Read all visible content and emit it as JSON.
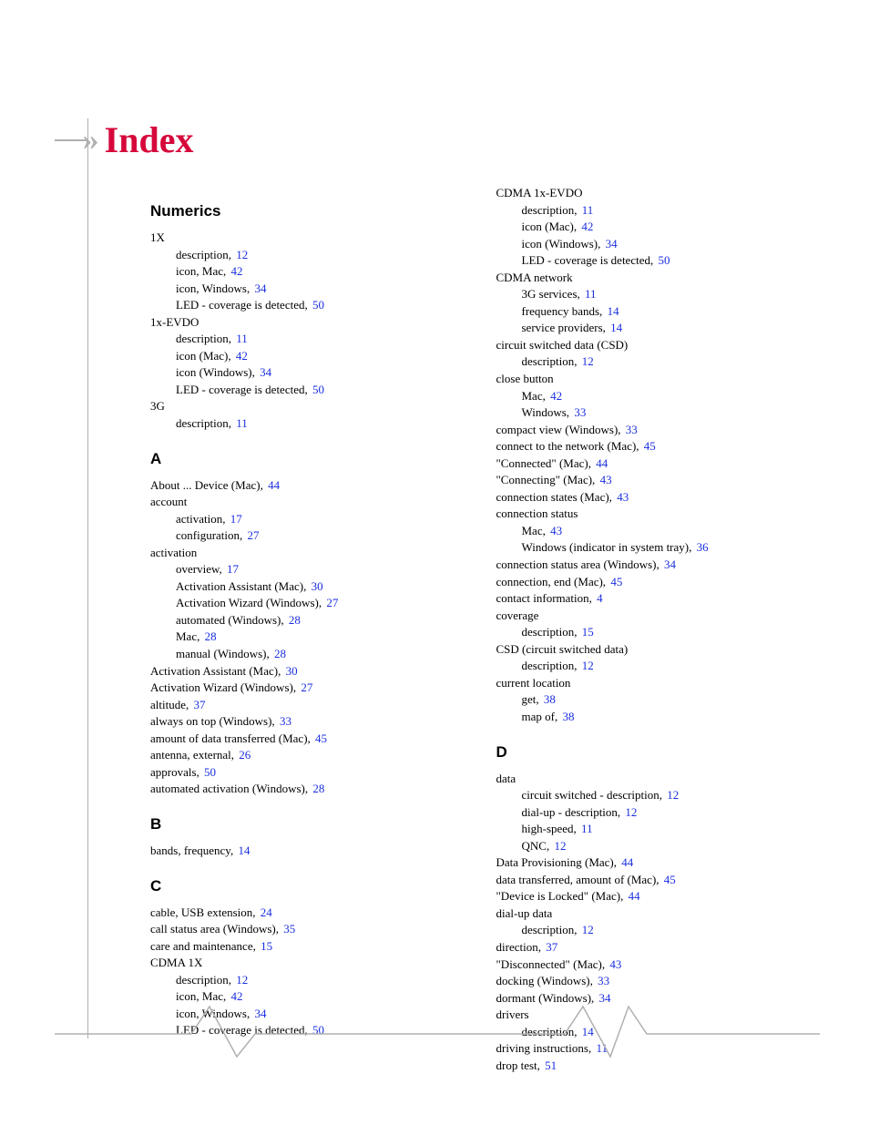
{
  "title": "Index",
  "sections": {
    "numerics": {
      "heading": "Numerics",
      "entries": [
        {
          "text": "1X",
          "lvl": 1
        },
        {
          "text": "description,",
          "page": "12",
          "lvl": 2
        },
        {
          "text": "icon, Mac,",
          "page": "42",
          "lvl": 2
        },
        {
          "text": "icon, Windows,",
          "page": "34",
          "lvl": 2
        },
        {
          "text": "LED - coverage is detected,",
          "page": "50",
          "lvl": 2
        },
        {
          "text": "1x-EVDO",
          "lvl": 1
        },
        {
          "text": "description,",
          "page": "11",
          "lvl": 2
        },
        {
          "text": "icon (Mac),",
          "page": "42",
          "lvl": 2
        },
        {
          "text": "icon (Windows),",
          "page": "34",
          "lvl": 2
        },
        {
          "text": "LED - coverage is detected,",
          "page": "50",
          "lvl": 2
        },
        {
          "text": "3G",
          "lvl": 1
        },
        {
          "text": "description,",
          "page": "11",
          "lvl": 2
        }
      ]
    },
    "a": {
      "heading": "A",
      "entries": [
        {
          "text": "About ... Device (Mac),",
          "page": "44",
          "lvl": 1
        },
        {
          "text": "account",
          "lvl": 1
        },
        {
          "text": "activation,",
          "page": "17",
          "lvl": 2
        },
        {
          "text": "configuration,",
          "page": "27",
          "lvl": 2
        },
        {
          "text": "activation",
          "lvl": 1
        },
        {
          "text": "overview,",
          "page": "17",
          "lvl": 2
        },
        {
          "text": "Activation Assistant (Mac),",
          "page": "30",
          "lvl": 2
        },
        {
          "text": "Activation Wizard (Windows),",
          "page": "27",
          "lvl": 2
        },
        {
          "text": "automated (Windows),",
          "page": "28",
          "lvl": 2
        },
        {
          "text": "Mac,",
          "page": "28",
          "lvl": 2
        },
        {
          "text": "manual (Windows),",
          "page": "28",
          "lvl": 2
        },
        {
          "text": "Activation Assistant (Mac),",
          "page": "30",
          "lvl": 1
        },
        {
          "text": "Activation Wizard (Windows),",
          "page": "27",
          "lvl": 1
        },
        {
          "text": "altitude,",
          "page": "37",
          "lvl": 1
        },
        {
          "text": "always on top (Windows),",
          "page": "33",
          "lvl": 1
        },
        {
          "text": "amount of data transferred (Mac),",
          "page": "45",
          "lvl": 1
        },
        {
          "text": "antenna, external,",
          "page": "26",
          "lvl": 1
        },
        {
          "text": "approvals,",
          "page": "50",
          "lvl": 1
        },
        {
          "text": "automated activation (Windows),",
          "page": "28",
          "lvl": 1
        }
      ]
    },
    "b": {
      "heading": "B",
      "entries": [
        {
          "text": "bands, frequency,",
          "page": "14",
          "lvl": 1
        }
      ]
    },
    "c": {
      "heading": "C",
      "entries": [
        {
          "text": "cable, USB extension,",
          "page": "24",
          "lvl": 1
        },
        {
          "text": "call status area (Windows),",
          "page": "35",
          "lvl": 1
        },
        {
          "text": "care and maintenance,",
          "page": "15",
          "lvl": 1
        },
        {
          "text": "CDMA 1X",
          "lvl": 1
        },
        {
          "text": "description,",
          "page": "12",
          "lvl": 2
        },
        {
          "text": "icon, Mac,",
          "page": "42",
          "lvl": 2
        },
        {
          "text": "icon, Windows,",
          "page": "34",
          "lvl": 2
        },
        {
          "text": "LED - coverage is detected,",
          "page": "50",
          "lvl": 2
        }
      ]
    },
    "c2": {
      "entries": [
        {
          "text": "CDMA 1x-EVDO",
          "lvl": 1
        },
        {
          "text": "description,",
          "page": "11",
          "lvl": 2
        },
        {
          "text": "icon (Mac),",
          "page": "42",
          "lvl": 2
        },
        {
          "text": "icon (Windows),",
          "page": "34",
          "lvl": 2
        },
        {
          "text": "LED - coverage is detected,",
          "page": "50",
          "lvl": 2
        },
        {
          "text": "CDMA network",
          "lvl": 1
        },
        {
          "text": "3G services,",
          "page": "11",
          "lvl": 2
        },
        {
          "text": "frequency bands,",
          "page": "14",
          "lvl": 2
        },
        {
          "text": "service providers,",
          "page": "14",
          "lvl": 2
        },
        {
          "text": "circuit switched data (CSD)",
          "lvl": 1
        },
        {
          "text": "description,",
          "page": "12",
          "lvl": 2
        },
        {
          "text": "close button",
          "lvl": 1
        },
        {
          "text": "Mac,",
          "page": "42",
          "lvl": 2
        },
        {
          "text": "Windows,",
          "page": "33",
          "lvl": 2
        },
        {
          "text": "compact view (Windows),",
          "page": "33",
          "lvl": 1
        },
        {
          "text": "connect to the network (Mac),",
          "page": "45",
          "lvl": 1
        },
        {
          "text": "\"Connected\" (Mac),",
          "page": "44",
          "lvl": 1
        },
        {
          "text": "\"Connecting\" (Mac),",
          "page": "43",
          "lvl": 1
        },
        {
          "text": "connection states (Mac),",
          "page": "43",
          "lvl": 1
        },
        {
          "text": "connection status",
          "lvl": 1
        },
        {
          "text": "Mac,",
          "page": "43",
          "lvl": 2
        },
        {
          "text": "Windows (indicator in system tray),",
          "page": "36",
          "lvl": 2
        },
        {
          "text": "connection status area (Windows),",
          "page": "34",
          "lvl": 1
        },
        {
          "text": "connection, end (Mac),",
          "page": "45",
          "lvl": 1
        },
        {
          "text": "contact information,",
          "page": "4",
          "lvl": 1
        },
        {
          "text": "coverage",
          "lvl": 1
        },
        {
          "text": "description,",
          "page": "15",
          "lvl": 2
        },
        {
          "text": "CSD (circuit switched data)",
          "lvl": 1
        },
        {
          "text": "description,",
          "page": "12",
          "lvl": 2
        },
        {
          "text": "current location",
          "lvl": 1
        },
        {
          "text": "get,",
          "page": "38",
          "lvl": 2
        },
        {
          "text": "map of,",
          "page": "38",
          "lvl": 2
        }
      ]
    },
    "d": {
      "heading": "D",
      "entries": [
        {
          "text": "data",
          "lvl": 1
        },
        {
          "text": "circuit switched - description,",
          "page": "12",
          "lvl": 2
        },
        {
          "text": "dial-up - description,",
          "page": "12",
          "lvl": 2
        },
        {
          "text": "high-speed,",
          "page": "11",
          "lvl": 2
        },
        {
          "text": "QNC,",
          "page": "12",
          "lvl": 2
        },
        {
          "text": "Data Provisioning (Mac),",
          "page": "44",
          "lvl": 1
        },
        {
          "text": "data transferred, amount of (Mac),",
          "page": "45",
          "lvl": 1
        },
        {
          "text": "\"Device is Locked\" (Mac),",
          "page": "44",
          "lvl": 1
        },
        {
          "text": "dial-up data",
          "lvl": 1
        },
        {
          "text": "description,",
          "page": "12",
          "lvl": 2
        },
        {
          "text": "direction,",
          "page": "37",
          "lvl": 1
        },
        {
          "text": "\"Disconnected\" (Mac),",
          "page": "43",
          "lvl": 1
        },
        {
          "text": "docking (Windows),",
          "page": "33",
          "lvl": 1
        },
        {
          "text": "dormant (Windows),",
          "page": "34",
          "lvl": 1
        },
        {
          "text": "drivers",
          "lvl": 1
        },
        {
          "text": "description,",
          "page": "14",
          "lvl": 2
        },
        {
          "text": "driving instructions,",
          "page": "11",
          "lvl": 1
        },
        {
          "text": "drop test,",
          "page": "51",
          "lvl": 1
        }
      ]
    }
  }
}
